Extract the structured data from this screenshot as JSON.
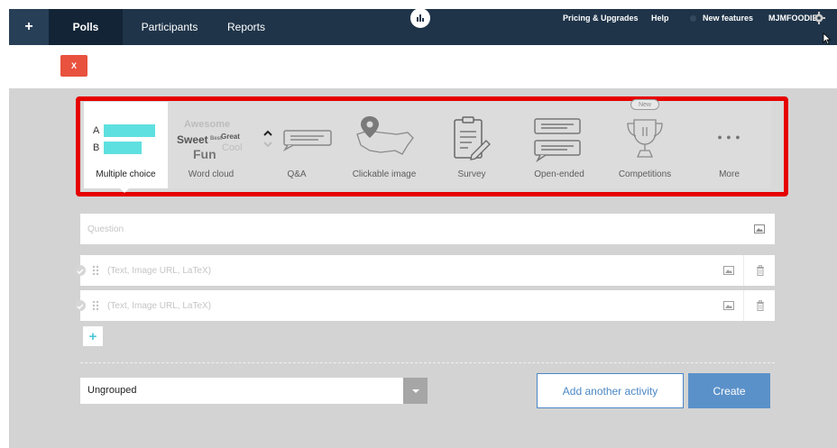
{
  "nav": {
    "plus": "+",
    "tabs": [
      {
        "label": "Polls"
      },
      {
        "label": "Participants"
      },
      {
        "label": "Reports"
      }
    ],
    "pricing": "Pricing & Upgrades",
    "help": "Help",
    "new_features": "New features",
    "user": "MJMFOODIE"
  },
  "toolbar": {
    "close_label": "X"
  },
  "activity_types": {
    "items": [
      {
        "label": "Multiple choice"
      },
      {
        "label": "Word cloud"
      },
      {
        "label": "Q&A"
      },
      {
        "label": "Clickable image"
      },
      {
        "label": "Survey"
      },
      {
        "label": "Open-ended"
      },
      {
        "label": "Competitions"
      },
      {
        "label": "More"
      }
    ],
    "mc_a": "A",
    "mc_b": "B",
    "word_cloud_words": [
      "Awesome",
      "Sweet",
      "Best",
      "Great",
      "Cool",
      "Fun"
    ],
    "new_badge": "New",
    "more_glyph": "● ● ●"
  },
  "form": {
    "question_placeholder": "Question",
    "option_placeholder": "(Text, Image URL, LaTeX)",
    "add_option": "+",
    "group_value": "Ungrouped",
    "add_activity_label": "Add another activity",
    "create_label": "Create"
  },
  "colors": {
    "nav_bg": "#1f3449",
    "highlight_border": "#e60000",
    "mc_bar": "#5fe0e0",
    "create_bg": "#5b91c9",
    "close_bg": "#e8523f"
  }
}
